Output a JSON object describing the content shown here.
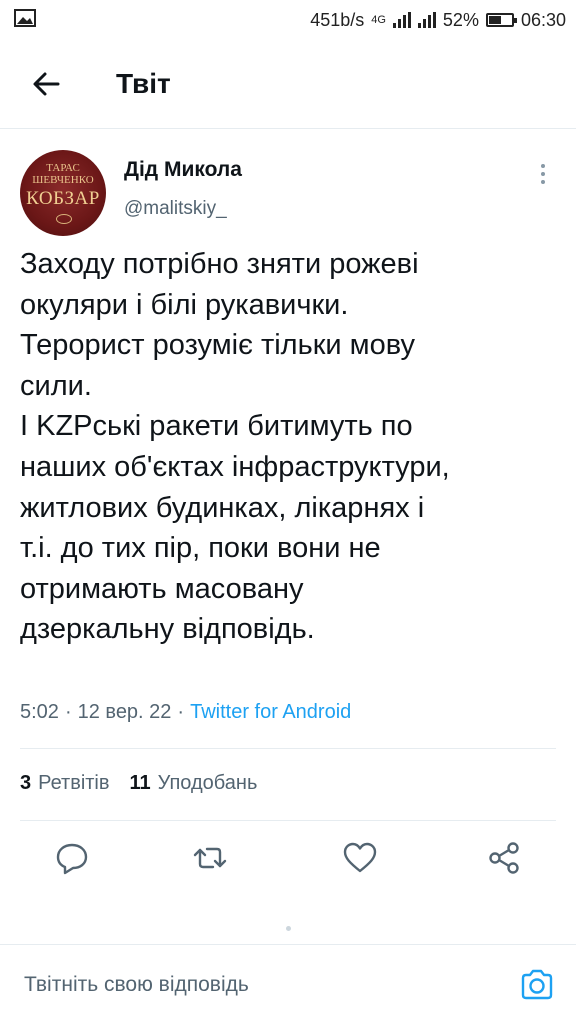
{
  "status_bar": {
    "speed": "451b/s",
    "network": "4G",
    "battery": "52%",
    "time": "06:30"
  },
  "app_bar": {
    "title": "Твіт"
  },
  "tweet": {
    "author_name": "Дід Микола",
    "author_handle": "@malitskiy_",
    "avatar_text_top_1": "ТАРАС",
    "avatar_text_top_2": "ШЕВЧЕНКО",
    "avatar_text_main": "КОБЗАР",
    "text_lines": [
      "Заходу потрібно зняти рожеві",
      "окуляри і білі рукавички.",
      "Терорист розуміє тільки мову",
      "сили.",
      "І KZPські ракети битимуть по",
      "наших об'єктах інфраструктури,",
      "житлових будинках, лікарнях і",
      "т.і. до тих пір, поки вони не",
      "отримають масовану",
      "дзеркальну відповідь."
    ],
    "time": "5:02",
    "date": "12 вер. 22",
    "source": "Twitter for Android",
    "retweets_count": "3",
    "retweets_label": "Ретвітів",
    "likes_count": "11",
    "likes_label": "Уподобань"
  },
  "reply": {
    "placeholder": "Твітніть свою відповідь"
  },
  "colors": {
    "accent": "#1da1f2",
    "secondary_text": "#536471",
    "divider": "#e6ecf0",
    "icon": "#536471"
  },
  "icons": [
    "back-arrow-icon",
    "more-vertical-icon",
    "reply-icon",
    "retweet-icon",
    "like-icon",
    "share-icon",
    "camera-icon"
  ]
}
